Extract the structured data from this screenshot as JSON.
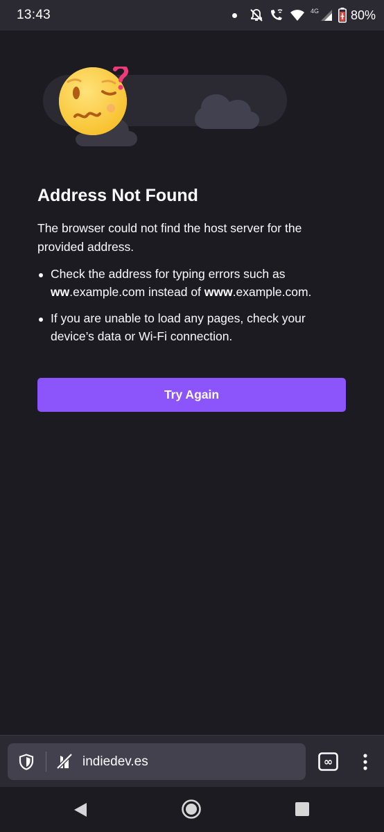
{
  "status_bar": {
    "time": "13:43",
    "network": "4G",
    "battery": "80%",
    "icons": [
      "notification-dot",
      "bell-off-icon",
      "wifi-call-icon",
      "wifi-icon",
      "cell-signal-icon",
      "battery-icon"
    ]
  },
  "error_page": {
    "illustration": "confused-face-with-question-mark",
    "title": "Address Not Found",
    "description": "The browser could not find the host server for the provided address.",
    "bullet_1": {
      "pre": "Check the address for typing errors such as ",
      "bold_1": "ww",
      "mid_1": ".example.com instead of ",
      "bold_2": "www",
      "end": ".example.com."
    },
    "bullet_2": "If you are unable to load any pages, check your device’s data or Wi-Fi connection.",
    "button_label": "Try Again"
  },
  "toolbar": {
    "url": "indiedev.es",
    "tabs_count_glyph": "∞"
  },
  "colors": {
    "background": "#1c1b22",
    "toolbar": "#2b2a33",
    "urlbar": "#42414d",
    "accent": "#8c55fb",
    "text": "#fbfbfe"
  }
}
